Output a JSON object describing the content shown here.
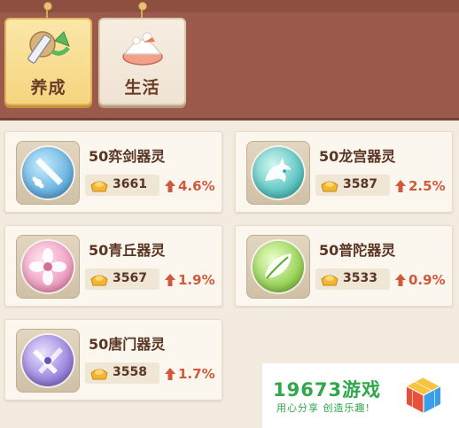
{
  "tabs": [
    {
      "label": "养成",
      "icon": "sword-upgrade-icon",
      "active": true
    },
    {
      "label": "生活",
      "icon": "food-bowl-icon",
      "active": false
    }
  ],
  "cards": [
    {
      "name": "50弈剑器灵",
      "price": "3661",
      "change": "4.6%",
      "icon": "sword-orb-icon",
      "orb_color": "#6ab3e0"
    },
    {
      "name": "50龙宫器灵",
      "price": "3587",
      "change": "2.5%",
      "icon": "dragon-orb-icon",
      "orb_color": "#5fc6c2"
    },
    {
      "name": "50青丘器灵",
      "price": "3567",
      "change": "1.9%",
      "icon": "flower-orb-icon",
      "orb_color": "#f0a2c3"
    },
    {
      "name": "50普陀器灵",
      "price": "3533",
      "change": "0.9%",
      "icon": "leaf-orb-icon",
      "orb_color": "#9ad45b"
    },
    {
      "name": "50唐门器灵",
      "price": "3558",
      "change": "1.7%",
      "icon": "dagger-orb-icon",
      "orb_color": "#9c86dd"
    }
  ],
  "currency_icon": "gold-ingot-icon",
  "trend_icon": "up-arrow-icon",
  "colors": {
    "header": "#9b5a4b",
    "active_tab": "#f5d57e",
    "price_up": "#d2583c",
    "watermark": "#2ea84a"
  },
  "watermark": {
    "title": "19673游戏",
    "slogan": "用心分享 创造乐趣!",
    "icon": "cube-logo-icon"
  }
}
